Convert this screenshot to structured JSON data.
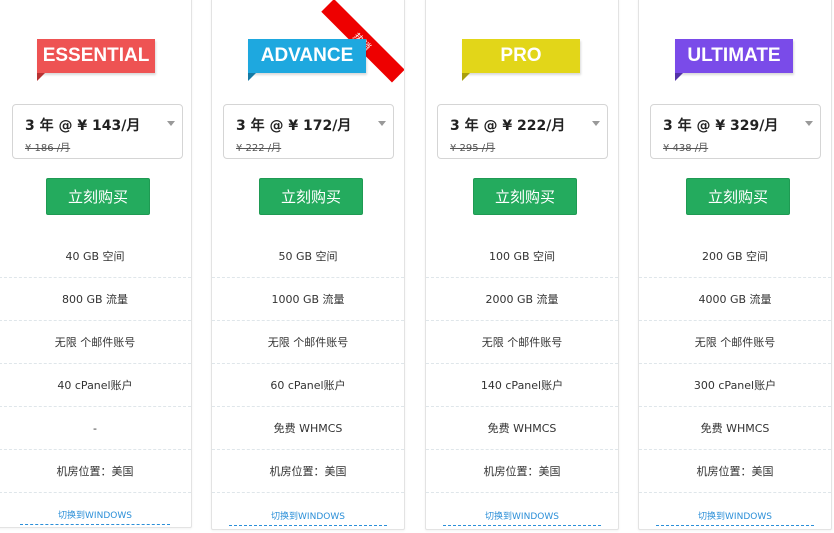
{
  "plans": [
    {
      "name": "ESSENTIAL",
      "color": "#ee5353",
      "price_label": "3 年 @ ¥ 143/月",
      "old_price": "¥ 186 /月",
      "buy_label": "立刻购买",
      "features": [
        "40 GB 空间",
        "800 GB 流量",
        "无限 个邮件账号",
        "40 cPanel账户",
        "-",
        "机房位置：美国"
      ],
      "switch_label": "切换到WINDOWS"
    },
    {
      "name": "ADVANCE",
      "color": "#1ea8df",
      "price_label": "3 年 @ ¥ 172/月",
      "old_price": "¥ 222 /月",
      "buy_label": "立刻购买",
      "badge": "热销",
      "features": [
        "50 GB 空间",
        "1000 GB 流量",
        "无限 个邮件账号",
        "60 cPanel账户",
        "免费 WHMCS",
        "机房位置：美国"
      ],
      "switch_label": "切换到WINDOWS"
    },
    {
      "name": "PRO",
      "color": "#e2d619",
      "price_label": "3 年 @ ¥ 222/月",
      "old_price": "¥ 295 /月",
      "buy_label": "立刻购买",
      "features": [
        "100 GB 空间",
        "2000 GB 流量",
        "无限 个邮件账号",
        "140 cPanel账户",
        "免费 WHMCS",
        "机房位置：美国"
      ],
      "switch_label": "切换到WINDOWS"
    },
    {
      "name": "ULTIMATE",
      "color": "#7a4be9",
      "price_label": "3 年 @ ¥ 329/月",
      "old_price": "¥ 438 /月",
      "buy_label": "立刻购买",
      "features": [
        "200 GB 空间",
        "4000 GB 流量",
        "无限 个邮件账号",
        "300 cPanel账户",
        "免费 WHMCS",
        "机房位置：美国"
      ],
      "switch_label": "切换到WINDOWS"
    }
  ],
  "icons": {
    "select_caret": "chevron-down-icon"
  }
}
